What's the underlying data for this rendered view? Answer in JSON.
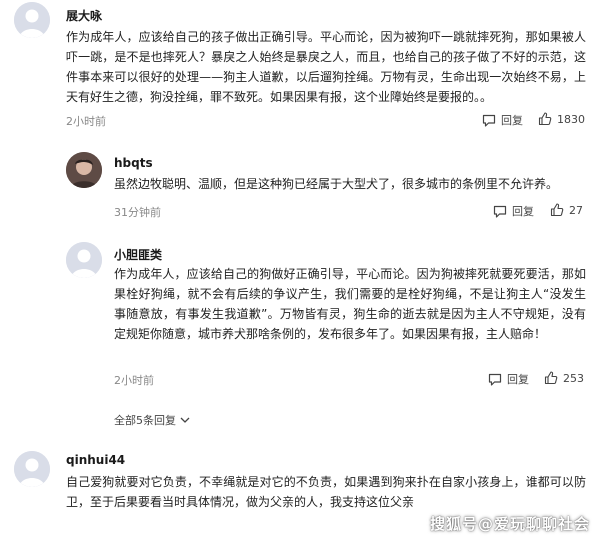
{
  "comments": [
    {
      "username": "展大咏",
      "text": "作为成年人，应该给自己的孩子做出正确引导。平心而论，因为被狗吓一跳就摔死狗，那如果被人吓一跳，是不是也摔死人？暴戾之人始终是暴戾之人，而且，也给自己的孩子做了不好的示范，这件事本来可以很好的处理——狗主人道歉，以后遛狗拴绳。万物有灵，生命出现一次始终不易，上天有好生之德，狗没拴绳，罪不致死。如果因果有报，这个业障始终是要报的。。",
      "time": "2小时前",
      "reply_label": "回复",
      "likes": "1830"
    },
    {
      "username": "hbqts",
      "text": "虽然边牧聪明、温顺，但是这种狗已经属于大型犬了，很多城市的条例里不允许养。",
      "time": "31分钟前",
      "reply_label": "回复",
      "likes": "27"
    },
    {
      "username": "小胆匪类",
      "text": "作为成年人，应该给自己的狗做好正确引导，平心而论。因为狗被摔死就要死要活，那如果栓好狗绳，就不会有后续的争议产生，我们需要的是栓好狗绳，不是让狗主人“没发生事随意放，有事发生我道歉”。万物皆有灵，狗生命的逝去就是因为主人不守规矩，没有定规矩你随意，城市养犬那啥条例的，发布很多年了。如果因果有报，主人赔命！",
      "time": "2小时前",
      "reply_label": "回复",
      "likes": "253"
    },
    {
      "username": "qinhui44",
      "text": "自己爱狗就要对它负责，不幸绳就是对它的不负责，如果遇到狗来扑在自家小孩身上，谁都可以防卫，至于后果要看当时具体情况，做为父亲的人，我支持这位父亲"
    }
  ],
  "expand_label": "全部5条回复",
  "watermark": "搜狐号@爱玩聊聊社会",
  "icons": {
    "avatar_default": "default-avatar-icon",
    "reply": "reply-icon",
    "like": "thumbs-up-icon",
    "expand": "chevron-down-icon"
  },
  "colors": {
    "text": "#222222",
    "meta": "#888888",
    "avatar_bg": "#d9dde8"
  }
}
